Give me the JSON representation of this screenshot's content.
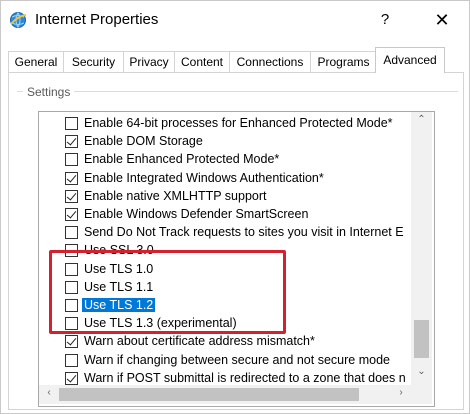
{
  "window": {
    "title": "Internet Properties",
    "help": "?",
    "close": "✕"
  },
  "tabs": [
    {
      "label": "General"
    },
    {
      "label": "Security"
    },
    {
      "label": "Privacy"
    },
    {
      "label": "Content"
    },
    {
      "label": "Connections"
    },
    {
      "label": "Programs"
    },
    {
      "label": "Advanced",
      "active": true
    }
  ],
  "settings": {
    "label": "Settings",
    "items": [
      {
        "label": "Enable 64-bit processes for Enhanced Protected Mode*",
        "checked": false
      },
      {
        "label": "Enable DOM Storage",
        "checked": true
      },
      {
        "label": "Enable Enhanced Protected Mode*",
        "checked": false
      },
      {
        "label": "Enable Integrated Windows Authentication*",
        "checked": true
      },
      {
        "label": "Enable native XMLHTTP support",
        "checked": true
      },
      {
        "label": "Enable Windows Defender SmartScreen",
        "checked": true
      },
      {
        "label": "Send Do Not Track requests to sites you visit in Internet E",
        "checked": false
      },
      {
        "label": "Use SSL 3.0",
        "checked": false
      },
      {
        "label": "Use TLS 1.0",
        "checked": false
      },
      {
        "label": "Use TLS 1.1",
        "checked": false
      },
      {
        "label": "Use TLS 1.2",
        "checked": false,
        "selected": true
      },
      {
        "label": "Use TLS 1.3 (experimental)",
        "checked": false
      },
      {
        "label": "Warn about certificate address mismatch*",
        "checked": true
      },
      {
        "label": "Warn if changing between secure and not secure mode",
        "checked": false
      },
      {
        "label": "Warn if POST submittal is redirected to a zone that does n",
        "checked": true
      }
    ]
  },
  "scrollbar": {
    "up": "⌃",
    "down": "⌄",
    "left": "‹",
    "right": "›"
  },
  "colors": {
    "highlight_border": "#d5202e",
    "selection": "#0078d7"
  },
  "icons": {
    "app": "internet-globe-icon"
  }
}
